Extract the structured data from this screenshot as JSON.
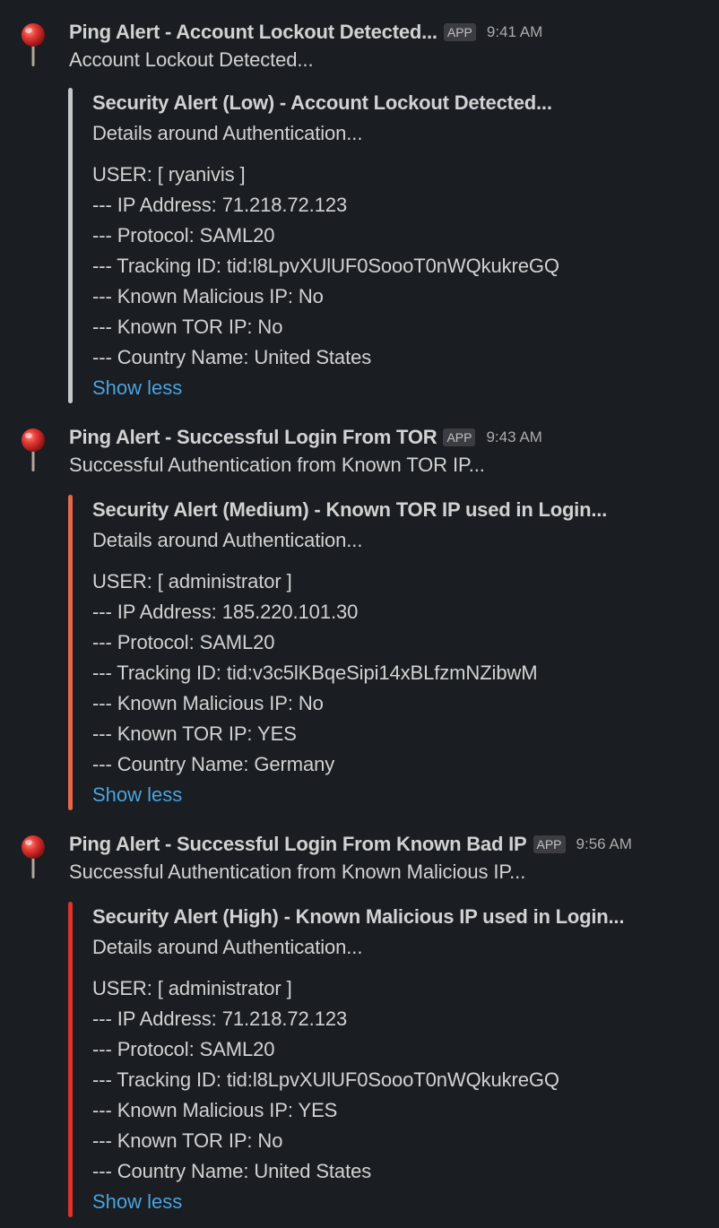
{
  "messages": [
    {
      "sender": "Ping Alert - Account Lockout Detected...",
      "badge": "APP",
      "time": "9:41 AM",
      "text": "Account Lockout Detected...",
      "attachment": {
        "color": "#c6c8ca",
        "title": "Security Alert (Low) - Account Lockout Detected...",
        "subtitle": "Details around Authentication...",
        "lines": [
          "USER: [ ryanivis ]",
          "--- IP Address: 71.218.72.123",
          "--- Protocol: SAML20",
          "--- Tracking ID: tid:l8LpvXUlUF0SoooT0nWQkukreGQ",
          "--- Known Malicious IP: No",
          "--- Known TOR IP: No",
          "--- Country Name: United States"
        ],
        "toggle": "Show less"
      }
    },
    {
      "sender": "Ping Alert - Successful Login From TOR",
      "badge": "APP",
      "time": "9:43 AM",
      "text": "Successful Authentication from Known TOR IP...",
      "attachment": {
        "color": "#e8674a",
        "title": "Security Alert (Medium) - Known TOR IP used in Login...",
        "subtitle": "Details around Authentication...",
        "lines": [
          "USER: [ administrator ]",
          "--- IP Address: 185.220.101.30",
          "--- Protocol: SAML20",
          "--- Tracking ID: tid:v3c5lKBqeSipi14xBLfzmNZibwM",
          "--- Known Malicious IP: No",
          "--- Known TOR IP: YES",
          "--- Country Name: Germany"
        ],
        "toggle": "Show less"
      }
    },
    {
      "sender": "Ping Alert - Successful Login From Known Bad IP",
      "badge": "APP",
      "time": "9:56 AM",
      "text": "Successful Authentication from Known Malicious IP...",
      "attachment": {
        "color": "#e0332b",
        "title": "Security Alert (High) - Known Malicious IP used in Login...",
        "subtitle": "Details around Authentication...",
        "lines": [
          "USER: [ administrator ]",
          "--- IP Address: 71.218.72.123",
          "--- Protocol: SAML20",
          "--- Tracking ID: tid:l8LpvXUlUF0SoooT0nWQkukreGQ",
          "--- Known Malicious IP: YES",
          "--- Known TOR IP: No",
          "--- Country Name: United States"
        ],
        "toggle": "Show less"
      }
    }
  ],
  "avatar_icon": "pushpin-icon"
}
